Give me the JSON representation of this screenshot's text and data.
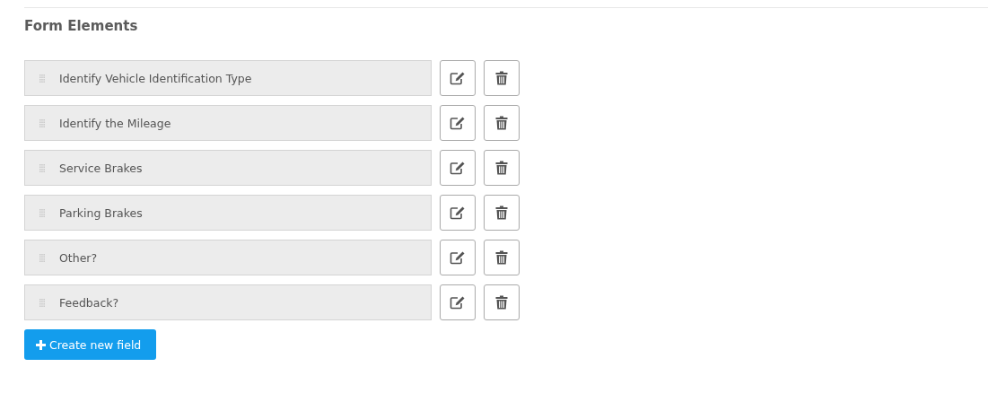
{
  "section": {
    "title": "Form Elements"
  },
  "fields": [
    {
      "label": "Identify Vehicle Identification Type"
    },
    {
      "label": "Identify the Mileage"
    },
    {
      "label": "Service Brakes"
    },
    {
      "label": "Parking Brakes"
    },
    {
      "label": "Other?"
    },
    {
      "label": "Feedback?"
    }
  ],
  "create_button": {
    "label": "Create new field"
  }
}
